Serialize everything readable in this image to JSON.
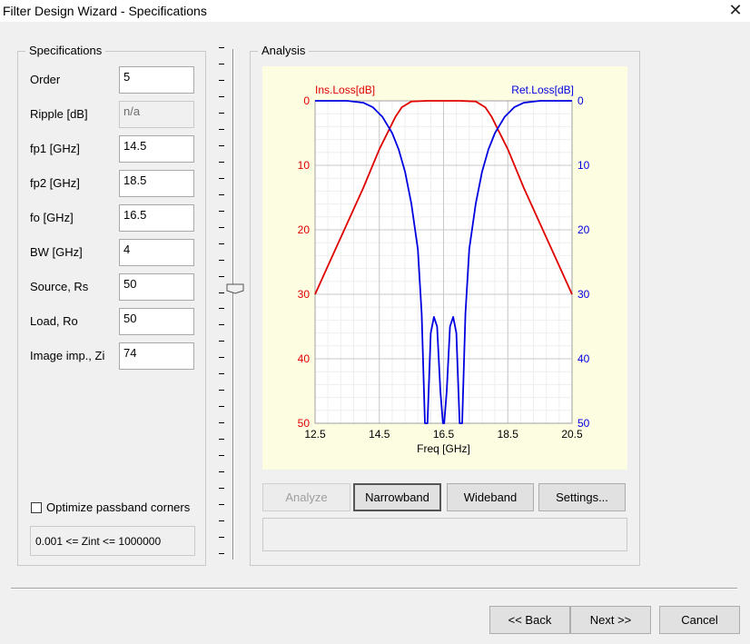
{
  "window": {
    "title": "Filter Design Wizard - Specifications",
    "close_glyph": "✕"
  },
  "specifications": {
    "group_title": "Specifications",
    "fields": [
      {
        "label": "Order",
        "value": "5",
        "enabled": true
      },
      {
        "label": "Ripple [dB]",
        "value": "n/a",
        "enabled": false
      },
      {
        "label": "fp1 [GHz]",
        "value": "14.5",
        "enabled": true
      },
      {
        "label": "fp2 [GHz]",
        "value": "18.5",
        "enabled": true
      },
      {
        "label": "fo [GHz]",
        "value": "16.5",
        "enabled": true
      },
      {
        "label": "BW [GHz]",
        "value": "4",
        "enabled": true
      },
      {
        "label": "Source, Rs",
        "value": "50",
        "enabled": true
      },
      {
        "label": "Load, Ro",
        "value": "50",
        "enabled": true
      },
      {
        "label": "Image imp., Zi",
        "value": "74",
        "enabled": true
      }
    ],
    "optimize_label": "Optimize passband corners",
    "optimize_checked": false,
    "zint_range": "0.001 <= Zint <= 1000000"
  },
  "slider": {
    "tick_count": 32,
    "position_fraction": 0.47
  },
  "analysis": {
    "group_title": "Analysis",
    "buttons": {
      "analyze": "Analyze",
      "narrowband": "Narrowband",
      "wideband": "Wideband",
      "settings": "Settings..."
    }
  },
  "chart_data": {
    "type": "line",
    "xlabel": "Freq [GHz]",
    "xlim": [
      12.5,
      20.5
    ],
    "x_ticks": [
      "12.5",
      "14.5",
      "16.5",
      "18.5",
      "20.5"
    ],
    "left_axis": {
      "label": "Ins.Loss[dB]",
      "ylim": [
        0,
        50
      ],
      "ticks": [
        "0",
        "10",
        "20",
        "30",
        "40",
        "50"
      ],
      "color": "#e00000",
      "inverted": true
    },
    "right_axis": {
      "label": "Ret.Loss[dB]",
      "ylim": [
        0,
        50
      ],
      "ticks": [
        "0",
        "10",
        "20",
        "30",
        "40",
        "50"
      ],
      "color": "#0000e0",
      "inverted": true
    },
    "grid": true,
    "series": [
      {
        "name": "Ins.Loss[dB]",
        "color": "#e00000",
        "x": [
          12.5,
          13.0,
          13.5,
          14.0,
          14.5,
          14.8,
          15.0,
          15.2,
          15.5,
          16.0,
          16.5,
          17.0,
          17.5,
          17.8,
          18.0,
          18.2,
          18.5,
          19.0,
          19.5,
          20.0,
          20.5
        ],
        "y": [
          30,
          24.5,
          19,
          13.5,
          7.5,
          4.5,
          2.5,
          1.0,
          0.1,
          0,
          0,
          0,
          0.1,
          1.0,
          2.5,
          4.5,
          7.5,
          13.5,
          19,
          24.5,
          30
        ]
      },
      {
        "name": "Ret.Loss[dB]",
        "color": "#0000e0",
        "x": [
          12.5,
          13.5,
          14.0,
          14.3,
          14.6,
          14.9,
          15.1,
          15.3,
          15.5,
          15.7,
          15.82,
          15.92,
          16.0,
          16.1,
          16.2,
          16.3,
          16.4,
          16.48,
          16.5,
          16.52,
          16.6,
          16.7,
          16.8,
          16.9,
          17.0,
          17.08,
          17.18,
          17.3,
          17.5,
          17.7,
          17.9,
          18.1,
          18.4,
          18.7,
          19.0,
          19.5,
          20.5
        ],
        "y": [
          0,
          0,
          0.3,
          1.0,
          2.5,
          5,
          7.5,
          11,
          16,
          23,
          33,
          50,
          50,
          36,
          33.5,
          35,
          45,
          50,
          50,
          50,
          45,
          35,
          33.5,
          36,
          50,
          50,
          33,
          23,
          16,
          11,
          7.5,
          5,
          2.5,
          1.0,
          0.3,
          0,
          0
        ]
      }
    ]
  },
  "footer": {
    "back": "<< Back",
    "next": "Next >>",
    "cancel": "Cancel"
  }
}
